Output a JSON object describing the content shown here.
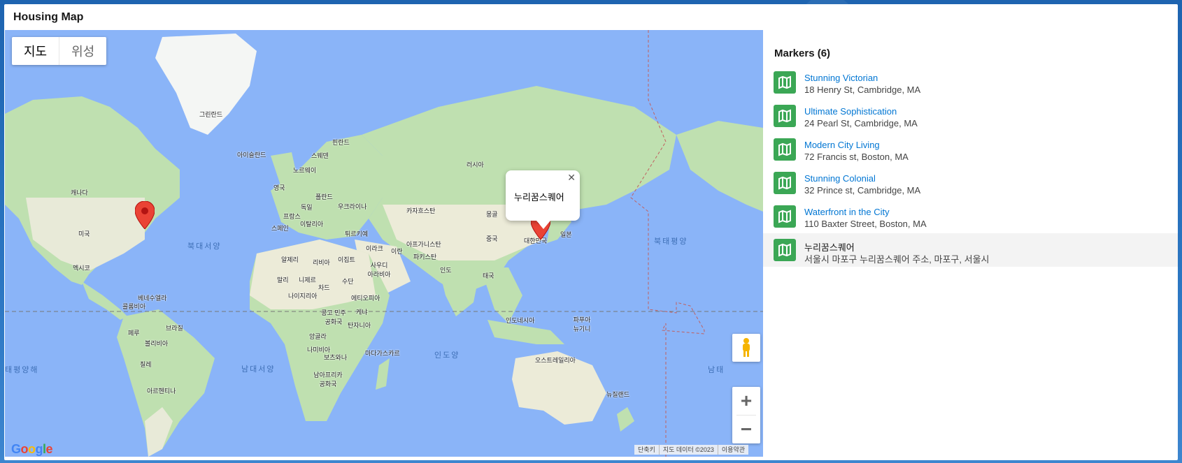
{
  "card": {
    "title": "Housing Map"
  },
  "map": {
    "map_types": [
      "지도",
      "위성"
    ],
    "selected_type": "지도",
    "info_window": {
      "text": "누리꿈스퀘어",
      "close": "✕"
    },
    "zoom_in": "+",
    "zoom_out": "−",
    "google_logo": "Google",
    "attribution": [
      "단축키",
      "지도 데이터 ©2023",
      "이용약관"
    ],
    "labels": {
      "greenland": "그린란드",
      "iceland": "아이슬란드",
      "finland": "핀란드",
      "sweden": "스웨덴",
      "norway": "노르웨이",
      "russia": "러시아",
      "uk": "영국",
      "germany": "독일",
      "poland": "폴란드",
      "ukraine": "우크라이나",
      "france": "프랑스",
      "spain": "스페인",
      "italy": "이탈리아",
      "turkey": "튀르키예",
      "kazakhstan": "카자흐스탄",
      "mongolia": "몽골",
      "china": "중국",
      "korea": "대한민국",
      "japan": "일본",
      "iraq": "이라크",
      "iran": "이란",
      "afghanistan": "아프가니스탄",
      "pakistan": "파키스탄",
      "india": "인도",
      "thailand": "태국",
      "saudi": "사우디 아라비아",
      "egypt": "이집트",
      "libya": "리비아",
      "algeria": "알제리",
      "mali": "말리",
      "niger": "니제르",
      "chad": "차드",
      "sudan": "수단",
      "nigeria": "나이지리아",
      "ethiopia": "에티오피아",
      "drc": "콩고 민주 공화국",
      "kenya": "케냐",
      "tanzania": "탄자니아",
      "angola": "앙골라",
      "namibia": "나미비아",
      "botswana": "보츠와나",
      "southafrica": "남아프리카 공화국",
      "madagascar": "마다가스카르",
      "canada": "캐나다",
      "usa": "미국",
      "mexico": "멕시코",
      "venezuela": "베네수엘라",
      "colombia": "콜롬비아",
      "peru": "페루",
      "brazil": "브라질",
      "bolivia": "볼리비아",
      "chile": "칠레",
      "argentina": "아르헨티나",
      "indonesia": "인도네시아",
      "png": "파푸아 뉴기니",
      "australia": "오스트레일리아",
      "nz": "뉴질랜드"
    },
    "oceans": {
      "north_atlantic": "북대서양",
      "south_atlantic": "남대서양",
      "indian": "인도양",
      "north_pacific": "북태평양",
      "south_pacific_left": "태평양해",
      "south_pacific_right": "남태"
    }
  },
  "markers": {
    "title": "Markers (6)",
    "items": [
      {
        "name": "Stunning Victorian",
        "address": "18 Henry St, Cambridge, MA"
      },
      {
        "name": "Ultimate Sophistication",
        "address": "24 Pearl St, Cambridge, MA"
      },
      {
        "name": "Modern City Living",
        "address": "72 Francis st, Boston, MA"
      },
      {
        "name": "Stunning Colonial",
        "address": "32 Prince st, Cambridge, MA"
      },
      {
        "name": "Waterfront in the City",
        "address": "110 Baxter Street, Boston, MA"
      },
      {
        "name": "누리꿈스퀘어",
        "address": "서울시 마포구 누리꿈스퀘어 주소, 마포구, 서울시"
      }
    ],
    "selected_index": 5,
    "icon": "map-icon",
    "icon_color": "#3ba755"
  },
  "colors": {
    "ocean": "#8ab4f8",
    "land": "#bfe0b0",
    "accent": "#0176d3",
    "pin": "#ea4335"
  }
}
